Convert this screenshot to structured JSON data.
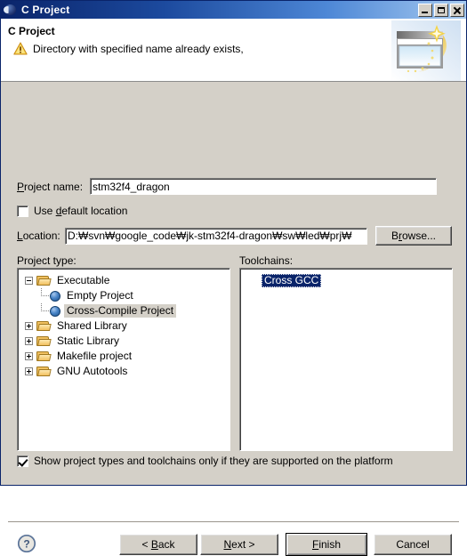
{
  "window": {
    "title": "C Project",
    "icon": "eclipse-sphere-icon",
    "controls": {
      "minimize": "Minimize",
      "maximize": "Maximize",
      "close": "Close"
    }
  },
  "header": {
    "title": "C Project",
    "message": "Directory with specified name already exists,",
    "status_icon": "warning-icon",
    "banner_icon": "new-project-wizard-banner"
  },
  "form": {
    "project_name_label": "Project name:",
    "project_name_value": "stm32f4_dragon",
    "use_default_location_label": "Use default location",
    "use_default_location_checked": false,
    "location_label": "Location:",
    "location_value": "D:₩svn₩google_code₩jk-stm32f4-dragon₩sw₩led₩prj₩",
    "browse_label": "Browse..."
  },
  "project_type": {
    "label": "Project type:",
    "nodes": [
      {
        "label": "Executable",
        "kind": "folder",
        "expander": "minus",
        "depth": 0,
        "selected": false
      },
      {
        "label": "Empty Project",
        "kind": "leaf",
        "depth": 1,
        "selected": false
      },
      {
        "label": "Cross-Compile Project",
        "kind": "leaf",
        "depth": 1,
        "selected": true
      },
      {
        "label": "Shared Library",
        "kind": "folder",
        "expander": "plus",
        "depth": 0,
        "selected": false
      },
      {
        "label": "Static Library",
        "kind": "folder",
        "expander": "plus",
        "depth": 0,
        "selected": false
      },
      {
        "label": "Makefile project",
        "kind": "folder",
        "expander": "plus",
        "depth": 0,
        "selected": false
      },
      {
        "label": "GNU Autotools",
        "kind": "folder",
        "expander": "plus",
        "depth": 0,
        "selected": false
      }
    ]
  },
  "toolchains": {
    "label": "Toolchains:",
    "items": [
      {
        "label": "Cross GCC",
        "selected": true
      }
    ]
  },
  "filter": {
    "label": "Show project types and toolchains only if they are supported on the platform",
    "checked": true
  },
  "footer": {
    "help_icon": "help-question-icon",
    "buttons": {
      "back": "< Back",
      "next": "Next >",
      "finish": "Finish",
      "cancel": "Cancel"
    },
    "default_button": "finish"
  },
  "colors": {
    "dialog_face": "#d4d0c8",
    "title_gradient_start": "#0a246a",
    "title_gradient_end": "#a6caf0",
    "selection_blue": "#0a246a",
    "field_white": "#ffffff",
    "warning_yellow": "#f0c040"
  }
}
